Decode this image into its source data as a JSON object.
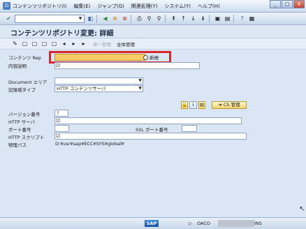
{
  "menubar": {
    "items": [
      "コンテンツリポジトリ(I)",
      "編集(E)",
      "ジャンプ(G)",
      "関連処理(Y)",
      "システム(Y)",
      "ヘルプ(H)"
    ]
  },
  "window": {
    "min": "_",
    "max": "□",
    "close": "X"
  },
  "screen": {
    "title": "コンテンツリポジトリ変更: 詳細"
  },
  "apptoolbar": {
    "single_admin": "単一管理",
    "full_admin": "全体管理"
  },
  "form": {
    "content_rep_label": "コンテンツ Rep",
    "new_label": "新規",
    "description_label": "内容説明",
    "document_area_label": "Document エリア",
    "storage_type_label": "記憶域タイプ",
    "storage_type_value": "HTTP コンテンツサーバ",
    "cs_admin_label": "CS 管理",
    "version_label": "バージョン番号",
    "version_value": "?",
    "http_server_label": "HTTP サーバ",
    "port_label": "ポート番号",
    "ssl_port_label": "SSL ポート番号",
    "http_script_label": "HTTP スクリプト",
    "phys_path_label": "物理パス",
    "phys_path_value": "D:¥usr¥sap¥ECC¥SYS¥global¥"
  },
  "status": {
    "sap": "SAP",
    "system": "OACO",
    "mode": "INS",
    "arrow": "▷"
  },
  "colors": {
    "required": "#f8cc62",
    "highlight": "#d7262e"
  }
}
